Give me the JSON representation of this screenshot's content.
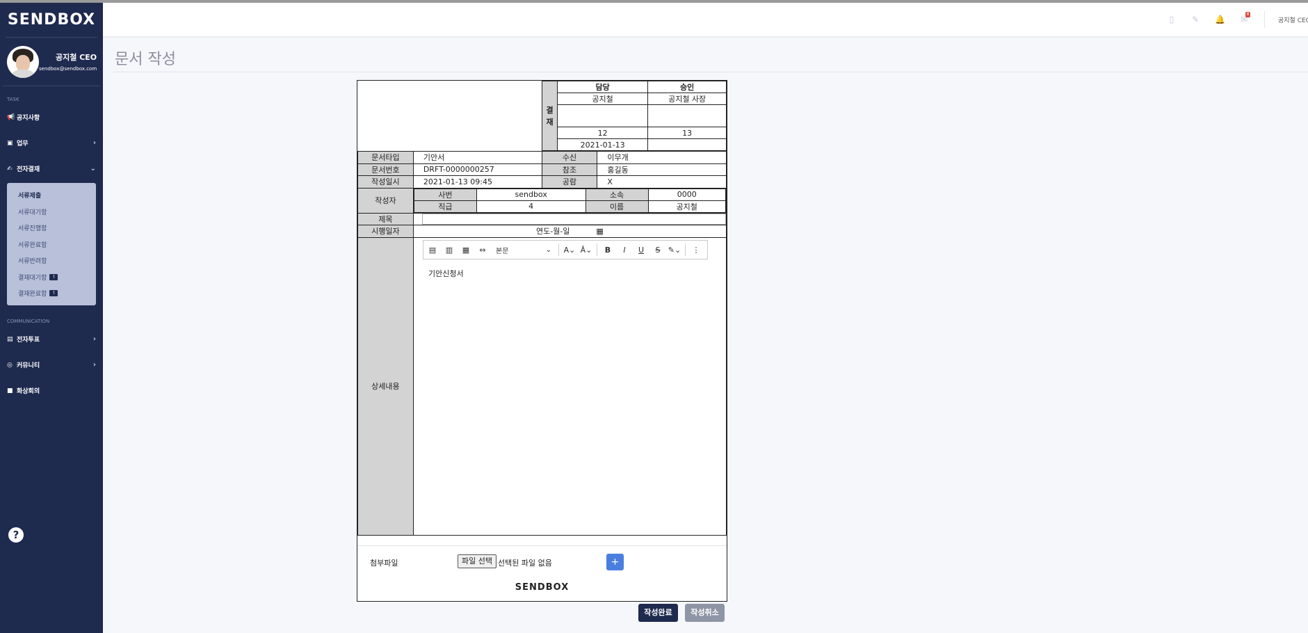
{
  "sidebar": {
    "brand": "SENDBOX",
    "user_name": "공지철 CEO",
    "user_email": "sendbox@sendbox.com",
    "section_task": "TASK",
    "section_comm": "COMMUNICATION",
    "items": [
      {
        "label": "공지사항",
        "icon": "megaphone-icon"
      },
      {
        "label": "업무",
        "icon": "briefcase-icon"
      },
      {
        "label": "전자결재",
        "icon": "signature-icon"
      }
    ],
    "submenu": [
      {
        "label": "서류제출"
      },
      {
        "label": "서류대기함"
      },
      {
        "label": "서류진행함"
      },
      {
        "label": "서류완료함"
      },
      {
        "label": "서류반려함"
      },
      {
        "label": "결재대기함"
      },
      {
        "label": "결재완료함"
      }
    ],
    "comm_items": [
      {
        "label": "전자투표",
        "icon": "vote-icon"
      },
      {
        "label": "커뮤니티",
        "icon": "gamepad-icon"
      },
      {
        "label": "화상회의",
        "icon": "video-icon"
      }
    ],
    "help": "?"
  },
  "topbar": {
    "badge_count": "8",
    "user": "공지철 CEO"
  },
  "page": {
    "title": "문서 작성"
  },
  "approval": {
    "side_label_1": "결",
    "side_label_2": "재",
    "col1_header": "담당",
    "col2_header": "승인",
    "col1_name": "공지철",
    "col2_name": "공지철 사장",
    "col1_no": "12",
    "col2_no": "13",
    "col1_date": "2021-01-13",
    "col2_date": ""
  },
  "doc": {
    "type_label": "문서타입",
    "type_value": "기안서",
    "recv_label": "수신",
    "recv_value": "이무개",
    "no_label": "문서번호",
    "no_value": "DRFT-0000000257",
    "ref_label": "참조",
    "ref_value": "홍길동",
    "date_label": "작성일시",
    "date_value": "2021-01-13 09:45",
    "share_label": "공람",
    "share_value": "X",
    "author_label": "작성자",
    "emp_no_label": "사번",
    "emp_no_value": "sendbox",
    "dept_label": "소속",
    "dept_value": "0000",
    "rank_label": "직급",
    "rank_value": "4",
    "name_label": "이름",
    "name_value": "공지철",
    "subject_label": "제목",
    "exec_date_label": "시행일자",
    "exec_date_placeholder": "연도-월-일",
    "detail_label": "상세내용",
    "editor_font": "본문",
    "editor_content": "기안신청서",
    "attach_label": "첨부파일",
    "file_button": "파일 선택",
    "file_none": "선택된 파일 없음",
    "add": "+",
    "logo": "SENDBOX"
  },
  "actions": {
    "submit": "작성완료",
    "cancel": "작성취소"
  }
}
